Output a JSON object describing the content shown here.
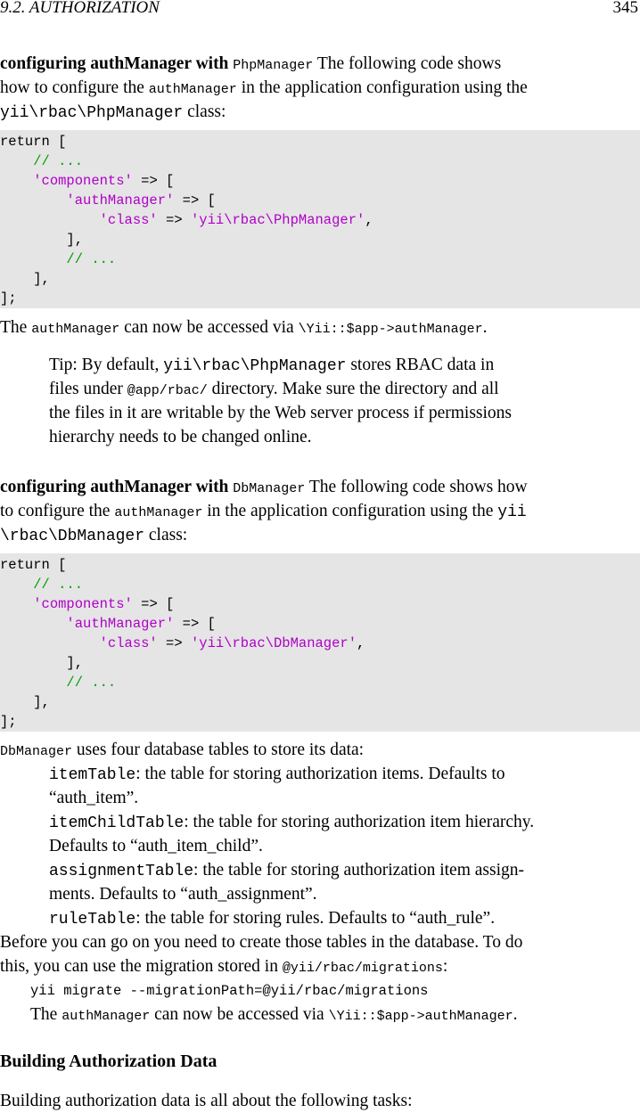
{
  "header": {
    "section": "9.2.   AUTHORIZATION",
    "page_number": "345"
  },
  "php": {
    "heading": "configuring authManager with",
    "heading_class": "PhpManager",
    "intro_after_heading": "The following code shows",
    "line2_a": "how to configure the",
    "line2_code": "authManager",
    "line2_b": "in the application configuration using the",
    "line3_code": "yii\\rbac\\PhpManager",
    "line3_b": "class:",
    "code": [
      "return [",
      "    // ...",
      "    'components' => [",
      "        'authManager' => [",
      "            'class' => 'yii\\rbac\\PhpManager',",
      "        ],",
      "        // ...",
      "    ],",
      "];"
    ],
    "after_a": "The",
    "after_code1": "authManager",
    "after_b": "can now be accessed via",
    "after_code2": "\\Yii::$app->authManager",
    "after_c": "."
  },
  "tip": {
    "l1_a": "Tip:  By default,",
    "l1_code": "yii\\rbac\\PhpManager",
    "l1_b": "stores RBAC data in",
    "l2_a": "files under",
    "l2_code": "@app/rbac/",
    "l2_b": "directory. Make sure the directory and all",
    "l3": "the files in it are writable by the Web server process if permissions",
    "l4": "hierarchy needs to be changed online."
  },
  "db": {
    "heading": "configuring authManager with",
    "heading_class": "DbManager",
    "intro_after_heading": "The following code shows how",
    "line2_a": "to configure the",
    "line2_code": "authManager",
    "line2_b": "in the application configuration using the",
    "line2_code2": "yii",
    "line3_code": "\\rbac\\DbManager",
    "line3_b": "class:",
    "code": [
      "return [",
      "    // ...",
      "    'components' => [",
      "        'authManager' => [",
      "            'class' => 'yii\\rbac\\DbManager',",
      "        ],",
      "        // ...",
      "    ],",
      "];"
    ],
    "uses_code": "DbManager",
    "uses_text": "uses four database tables to store its data:",
    "tables": [
      {
        "name": "itemTable",
        "l1": ": the table for storing authorization items.  Defaults to",
        "l2": "“auth_item”."
      },
      {
        "name": "itemChildTable",
        "l1": ": the table for storing authorization item hierarchy.",
        "l2": "Defaults to “auth_item_child”."
      },
      {
        "name": "assignmentTable",
        "l1": ": the table for storing authorization item assign-",
        "l2": "ments. Defaults to “auth_assignment”."
      },
      {
        "name": "ruleTable",
        "l1": ": the table for storing rules. Defaults to “auth_rule”.",
        "l2": ""
      }
    ],
    "before_l1": "Before you can go on you need to create those tables in the database. To do",
    "before_l2_a": "this, you can use the migration stored in",
    "before_l2_code": "@yii/rbac/migrations",
    "before_l2_b": ":",
    "cmd": "yii migrate --migrationPath=@yii/rbac/migrations",
    "after_a": "The",
    "after_code1": "authManager",
    "after_b": "can now be accessed via",
    "after_code2": "\\Yii::$app->authManager",
    "after_c": "."
  },
  "building": {
    "heading": "Building Authorization Data",
    "intro": "Building authorization data is all about the following tasks:"
  }
}
